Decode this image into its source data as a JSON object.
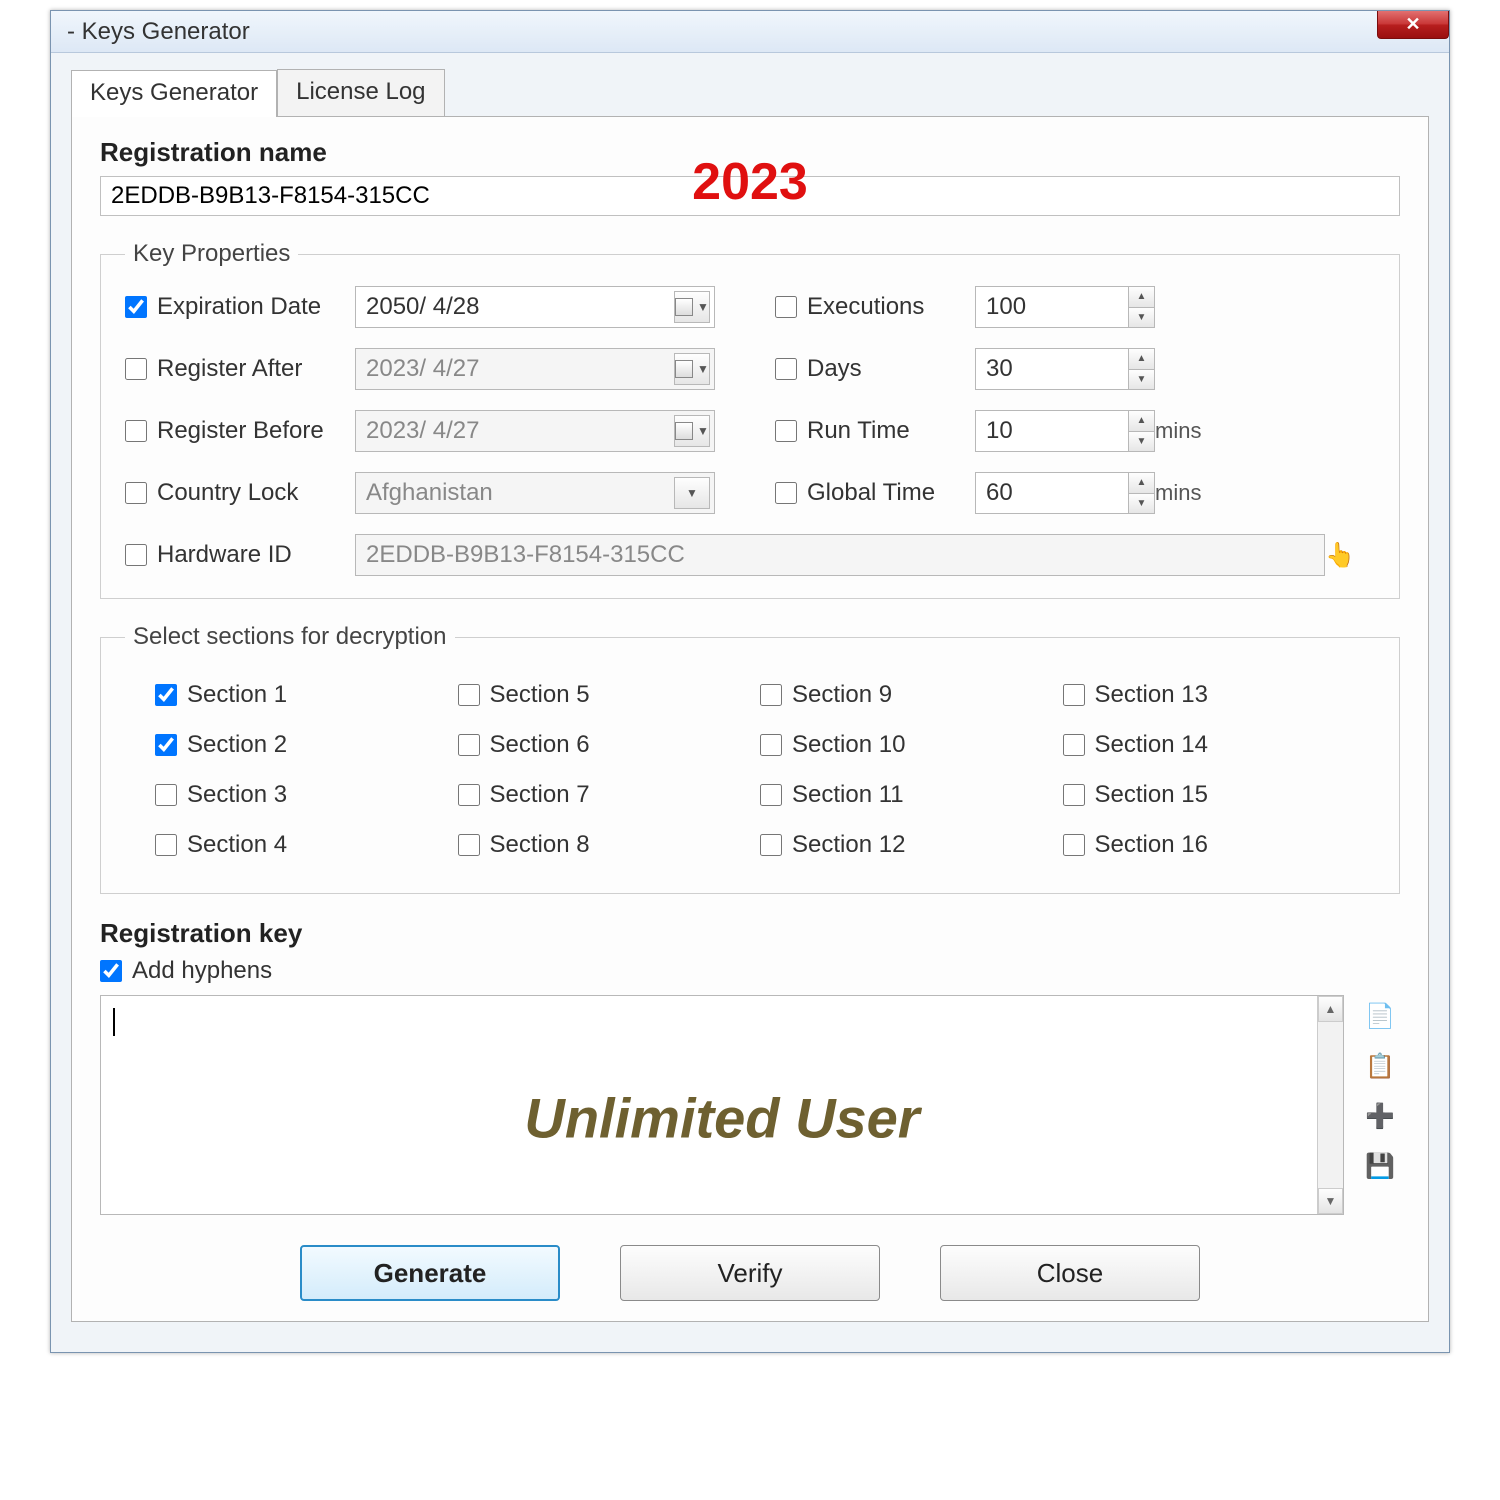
{
  "window": {
    "title": "- Keys Generator"
  },
  "tabs": {
    "generator": "Keys Generator",
    "log": "License Log"
  },
  "registration": {
    "label": "Registration name",
    "value": "2EDDB-B9B13-F8154-315CC"
  },
  "overlay": {
    "year": "2023",
    "unlimited": "Unlimited User"
  },
  "keyprops": {
    "legend": "Key Properties",
    "expiration": {
      "label": "Expiration Date",
      "checked": true,
      "value": "2050/  4/28"
    },
    "register_after": {
      "label": "Register After",
      "checked": false,
      "value": "2023/  4/27"
    },
    "register_before": {
      "label": "Register Before",
      "checked": false,
      "value": "2023/  4/27"
    },
    "country_lock": {
      "label": "Country Lock",
      "checked": false,
      "value": "Afghanistan"
    },
    "hardware_id": {
      "label": "Hardware ID",
      "checked": false,
      "value": "2EDDB-B9B13-F8154-315CC"
    },
    "executions": {
      "label": "Executions",
      "checked": false,
      "value": "100"
    },
    "days": {
      "label": "Days",
      "checked": false,
      "value": "30"
    },
    "runtime": {
      "label": "Run Time",
      "checked": false,
      "value": "10",
      "unit": "mins"
    },
    "globaltime": {
      "label": "Global Time",
      "checked": false,
      "value": "60",
      "unit": "mins"
    }
  },
  "sections": {
    "legend": "Select sections for decryption",
    "items": [
      {
        "label": "Section 1",
        "checked": true
      },
      {
        "label": "Section 2",
        "checked": true
      },
      {
        "label": "Section 3",
        "checked": false
      },
      {
        "label": "Section 4",
        "checked": false
      },
      {
        "label": "Section 5",
        "checked": false
      },
      {
        "label": "Section 6",
        "checked": false
      },
      {
        "label": "Section 7",
        "checked": false
      },
      {
        "label": "Section 8",
        "checked": false
      },
      {
        "label": "Section 9",
        "checked": false
      },
      {
        "label": "Section 10",
        "checked": false
      },
      {
        "label": "Section 11",
        "checked": false
      },
      {
        "label": "Section 12",
        "checked": false
      },
      {
        "label": "Section 13",
        "checked": false
      },
      {
        "label": "Section 14",
        "checked": false
      },
      {
        "label": "Section 15",
        "checked": false
      },
      {
        "label": "Section 16",
        "checked": false
      }
    ]
  },
  "regkey": {
    "label": "Registration key",
    "add_hyphens": {
      "label": "Add hyphens",
      "checked": true
    },
    "value": ""
  },
  "buttons": {
    "generate": "Generate",
    "verify": "Verify",
    "close": "Close"
  }
}
